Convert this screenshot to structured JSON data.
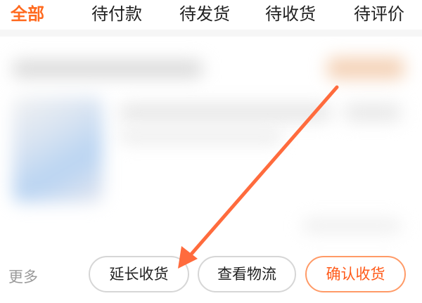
{
  "tabs": [
    {
      "label": "全部",
      "active": true
    },
    {
      "label": "待付款",
      "active": false
    },
    {
      "label": "待发货",
      "active": false
    },
    {
      "label": "待收货",
      "active": false
    },
    {
      "label": "待评价",
      "active": false
    }
  ],
  "footer": {
    "more_label": "更多",
    "buttons": {
      "extend_receipt": "延长收货",
      "view_logistics": "查看物流",
      "confirm_receipt": "确认收货"
    }
  },
  "colors": {
    "accent": "#ff6a1f",
    "confirm_border": "#ff9a67",
    "arrow": "#ff6b3d"
  },
  "icons": {
    "annotation_arrow": "arrow-icon"
  }
}
